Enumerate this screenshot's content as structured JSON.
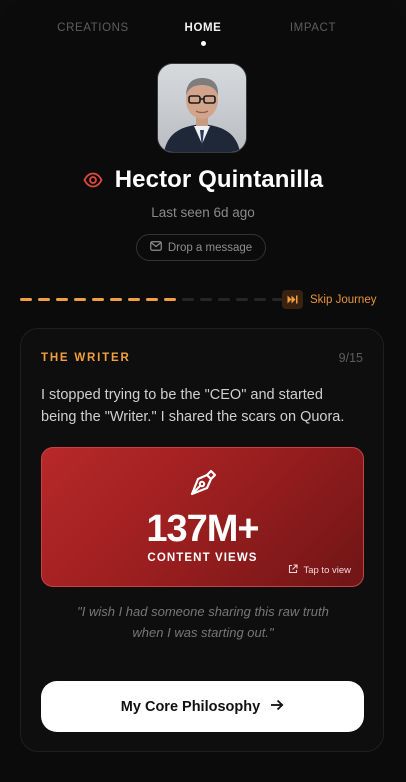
{
  "tabs": [
    {
      "label": "CREATIONS",
      "active": false
    },
    {
      "label": "HOME",
      "active": true
    },
    {
      "label": "IMPACT",
      "active": false
    }
  ],
  "profile": {
    "name": "Hector Quintanilla",
    "last_seen": "Last seen 6d ago",
    "message_label": "Drop a message"
  },
  "journey": {
    "progress_steps_total": 15,
    "progress_steps_done": 9,
    "skip_label": "Skip Journey"
  },
  "card": {
    "kicker": "THE WRITER",
    "count": "9/15",
    "body": "I stopped trying to be the \"CEO\" and started being the \"Writer.\" I shared the scars on Quora.",
    "stat_value": "137M+",
    "stat_label": "CONTENT VIEWS",
    "stat_tap": "Tap to view",
    "quote": "\"I wish I had someone sharing this raw truth when I was starting out.\"",
    "cta_label": "My Core Philosophy"
  },
  "colors": {
    "accent": "#f0a040",
    "eye": "#e0483e",
    "stat_bg": "#a82122"
  }
}
